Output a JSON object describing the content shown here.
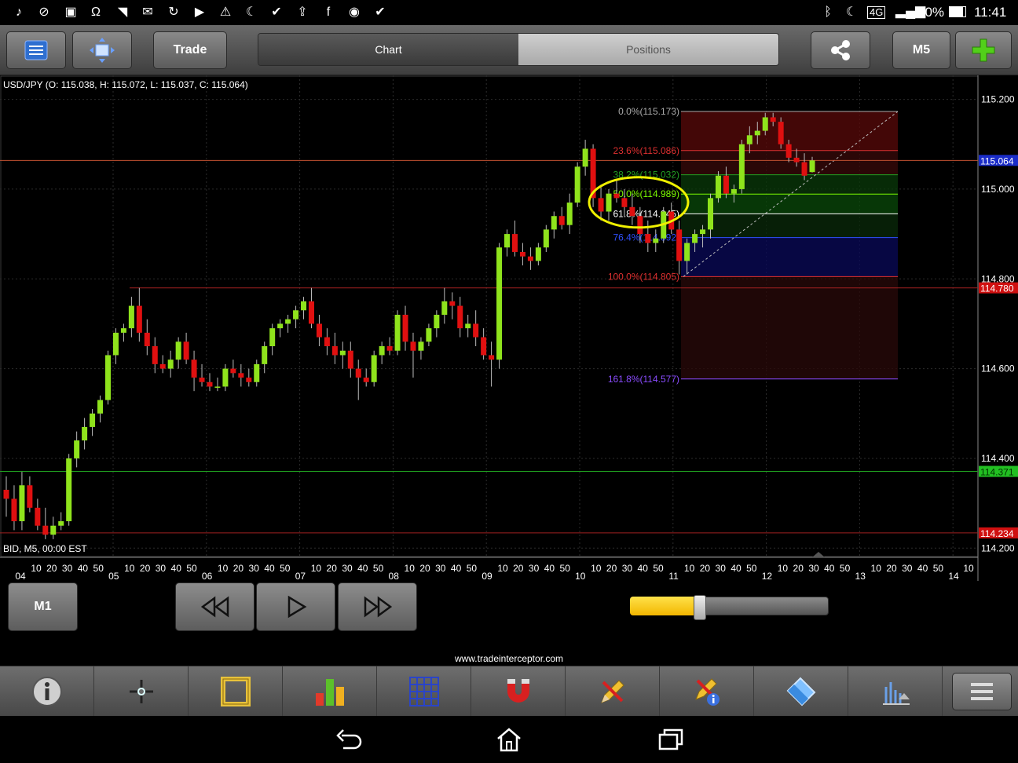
{
  "status_bar": {
    "left_icons": [
      "music-icon",
      "no-sim-icon",
      "image-icon",
      "headset-icon",
      "wifi-question-icon",
      "gmail-icon",
      "sync-icon",
      "youtube-icon",
      "warning-icon",
      "moon-icon",
      "clipboard-check-icon",
      "clipboard-up-icon",
      "facebook-icon",
      "messenger-icon",
      "clipboard-check-icon"
    ],
    "battery": "90%",
    "time": "11:41",
    "network": "4G"
  },
  "toolbar": {
    "trade_label": "Trade",
    "tabs": [
      {
        "label": "Chart",
        "active": true
      },
      {
        "label": "Positions",
        "active": false
      }
    ],
    "timeframe_label": "M5"
  },
  "chart": {
    "pair_info": "USD/JPY (O: 115.038, H: 115.072, L: 115.037, C: 115.064)",
    "bid_info": "BID, M5, 00:00 EST",
    "price_ticks": [
      {
        "label": "115.200",
        "v": 115.2
      },
      {
        "label": "115.000",
        "v": 115.0
      },
      {
        "label": "114.800",
        "v": 114.8
      },
      {
        "label": "114.600",
        "v": 114.6
      },
      {
        "label": "114.400",
        "v": 114.4
      },
      {
        "label": "114.200",
        "v": 114.2
      }
    ],
    "price_markers": [
      {
        "label": "115.064",
        "v": 115.064,
        "bg": "#1a2cc8",
        "color": "#ffffff",
        "line": "#c05030"
      },
      {
        "label": "114.780",
        "v": 114.78,
        "bg": "#d01010",
        "color": "#ffffff",
        "line": "#a02020"
      },
      {
        "label": "114.371",
        "v": 114.371,
        "bg": "#22c022",
        "color": "#003300",
        "line": "#20a020"
      },
      {
        "label": "114.234",
        "v": 114.234,
        "bg": "#d01010",
        "color": "#ffffff",
        "line": "#a02020"
      }
    ],
    "fib_levels": [
      {
        "label": "0.0%(115.173)",
        "v": 115.173,
        "color": "#aaaaaa"
      },
      {
        "label": "23.6%(115.086)",
        "v": 115.086,
        "color": "#e03030"
      },
      {
        "label": "38.2%(115.032)",
        "v": 115.032,
        "color": "#22a022"
      },
      {
        "label": "50.0%(114.989)",
        "v": 114.989,
        "color": "#7cfc00"
      },
      {
        "label": "61.8%(114.945)",
        "v": 114.945,
        "color": "#ffffff"
      },
      {
        "label": "76.4%(114.892)",
        "v": 114.892,
        "color": "#3050ff"
      },
      {
        "label": "100.0%(114.805)",
        "v": 114.805,
        "color": "#e03030"
      },
      {
        "label": "161.8%(114.577)",
        "v": 114.577,
        "color": "#8a4cff"
      }
    ],
    "time_axis": {
      "minor": [
        "10",
        "20",
        "30",
        "40",
        "50"
      ],
      "days": [
        "04",
        "05",
        "06",
        "07",
        "08",
        "09",
        "10",
        "11",
        "12",
        "13",
        "14"
      ]
    },
    "colors": {
      "up": "#8fe31c",
      "down": "#e01010",
      "grid": "#2c2c2c",
      "highlight": "#f0f000"
    }
  },
  "chart_data": {
    "type": "candlestick",
    "title": "USD/JPY (O: 115.038, H: 115.072, L: 115.037, C: 115.064)",
    "ylim": [
      114.2,
      115.2
    ],
    "x": [
      "04",
      "05",
      "06",
      "07",
      "08",
      "09",
      "10",
      "11",
      "12"
    ],
    "candles": [
      {
        "o": 114.33,
        "h": 114.36,
        "l": 114.27,
        "c": 114.31
      },
      {
        "o": 114.31,
        "h": 114.34,
        "l": 114.24,
        "c": 114.26
      },
      {
        "o": 114.26,
        "h": 114.37,
        "l": 114.24,
        "c": 114.34
      },
      {
        "o": 114.34,
        "h": 114.36,
        "l": 114.28,
        "c": 114.29
      },
      {
        "o": 114.29,
        "h": 114.31,
        "l": 114.24,
        "c": 114.25
      },
      {
        "o": 114.25,
        "h": 114.29,
        "l": 114.22,
        "c": 114.23
      },
      {
        "o": 114.23,
        "h": 114.27,
        "l": 114.22,
        "c": 114.25
      },
      {
        "o": 114.25,
        "h": 114.28,
        "l": 114.24,
        "c": 114.26
      },
      {
        "o": 114.26,
        "h": 114.41,
        "l": 114.25,
        "c": 114.4
      },
      {
        "o": 114.4,
        "h": 114.46,
        "l": 114.38,
        "c": 114.44
      },
      {
        "o": 114.44,
        "h": 114.49,
        "l": 114.42,
        "c": 114.47
      },
      {
        "o": 114.47,
        "h": 114.51,
        "l": 114.45,
        "c": 114.5
      },
      {
        "o": 114.5,
        "h": 114.54,
        "l": 114.48,
        "c": 114.53
      },
      {
        "o": 114.53,
        "h": 114.64,
        "l": 114.52,
        "c": 114.63
      },
      {
        "o": 114.63,
        "h": 114.69,
        "l": 114.61,
        "c": 114.68
      },
      {
        "o": 114.68,
        "h": 114.7,
        "l": 114.66,
        "c": 114.69
      },
      {
        "o": 114.69,
        "h": 114.76,
        "l": 114.67,
        "c": 114.74
      },
      {
        "o": 114.74,
        "h": 114.78,
        "l": 114.66,
        "c": 114.68
      },
      {
        "o": 114.68,
        "h": 114.71,
        "l": 114.63,
        "c": 114.65
      },
      {
        "o": 114.65,
        "h": 114.67,
        "l": 114.59,
        "c": 114.61
      },
      {
        "o": 114.61,
        "h": 114.63,
        "l": 114.59,
        "c": 114.6
      },
      {
        "o": 114.6,
        "h": 114.64,
        "l": 114.58,
        "c": 114.62
      },
      {
        "o": 114.62,
        "h": 114.67,
        "l": 114.6,
        "c": 114.66
      },
      {
        "o": 114.66,
        "h": 114.68,
        "l": 114.61,
        "c": 114.62
      },
      {
        "o": 114.62,
        "h": 114.64,
        "l": 114.55,
        "c": 114.58
      },
      {
        "o": 114.58,
        "h": 114.61,
        "l": 114.56,
        "c": 114.57
      },
      {
        "o": 114.57,
        "h": 114.59,
        "l": 114.55,
        "c": 114.56
      },
      {
        "o": 114.56,
        "h": 114.58,
        "l": 114.55,
        "c": 114.56
      },
      {
        "o": 114.56,
        "h": 114.61,
        "l": 114.55,
        "c": 114.6
      },
      {
        "o": 114.6,
        "h": 114.62,
        "l": 114.58,
        "c": 114.59
      },
      {
        "o": 114.59,
        "h": 114.61,
        "l": 114.56,
        "c": 114.58
      },
      {
        "o": 114.58,
        "h": 114.6,
        "l": 114.56,
        "c": 114.57
      },
      {
        "o": 114.57,
        "h": 114.62,
        "l": 114.56,
        "c": 114.61
      },
      {
        "o": 114.61,
        "h": 114.66,
        "l": 114.59,
        "c": 114.65
      },
      {
        "o": 114.65,
        "h": 114.7,
        "l": 114.63,
        "c": 114.69
      },
      {
        "o": 114.69,
        "h": 114.71,
        "l": 114.67,
        "c": 114.7
      },
      {
        "o": 114.7,
        "h": 114.72,
        "l": 114.68,
        "c": 114.71
      },
      {
        "o": 114.71,
        "h": 114.74,
        "l": 114.69,
        "c": 114.73
      },
      {
        "o": 114.73,
        "h": 114.76,
        "l": 114.71,
        "c": 114.75
      },
      {
        "o": 114.75,
        "h": 114.78,
        "l": 114.69,
        "c": 114.7
      },
      {
        "o": 114.7,
        "h": 114.72,
        "l": 114.65,
        "c": 114.67
      },
      {
        "o": 114.67,
        "h": 114.69,
        "l": 114.63,
        "c": 114.65
      },
      {
        "o": 114.65,
        "h": 114.68,
        "l": 114.61,
        "c": 114.63
      },
      {
        "o": 114.63,
        "h": 114.66,
        "l": 114.6,
        "c": 114.64
      },
      {
        "o": 114.64,
        "h": 114.66,
        "l": 114.58,
        "c": 114.6
      },
      {
        "o": 114.6,
        "h": 114.62,
        "l": 114.53,
        "c": 114.58
      },
      {
        "o": 114.58,
        "h": 114.6,
        "l": 114.56,
        "c": 114.57
      },
      {
        "o": 114.57,
        "h": 114.64,
        "l": 114.56,
        "c": 114.63
      },
      {
        "o": 114.63,
        "h": 114.66,
        "l": 114.61,
        "c": 114.65
      },
      {
        "o": 114.65,
        "h": 114.67,
        "l": 114.63,
        "c": 114.64
      },
      {
        "o": 114.64,
        "h": 114.73,
        "l": 114.63,
        "c": 114.72
      },
      {
        "o": 114.72,
        "h": 114.74,
        "l": 114.64,
        "c": 114.66
      },
      {
        "o": 114.66,
        "h": 114.68,
        "l": 114.58,
        "c": 114.64
      },
      {
        "o": 114.64,
        "h": 114.67,
        "l": 114.62,
        "c": 114.66
      },
      {
        "o": 114.66,
        "h": 114.7,
        "l": 114.65,
        "c": 114.69
      },
      {
        "o": 114.69,
        "h": 114.73,
        "l": 114.67,
        "c": 114.72
      },
      {
        "o": 114.72,
        "h": 114.78,
        "l": 114.7,
        "c": 114.75
      },
      {
        "o": 114.75,
        "h": 114.77,
        "l": 114.71,
        "c": 114.74
      },
      {
        "o": 114.74,
        "h": 114.76,
        "l": 114.67,
        "c": 114.69
      },
      {
        "o": 114.69,
        "h": 114.72,
        "l": 114.67,
        "c": 114.7
      },
      {
        "o": 114.7,
        "h": 114.73,
        "l": 114.65,
        "c": 114.67
      },
      {
        "o": 114.67,
        "h": 114.69,
        "l": 114.62,
        "c": 114.63
      },
      {
        "o": 114.63,
        "h": 114.66,
        "l": 114.56,
        "c": 114.62
      },
      {
        "o": 114.62,
        "h": 114.88,
        "l": 114.6,
        "c": 114.87
      },
      {
        "o": 114.87,
        "h": 114.91,
        "l": 114.85,
        "c": 114.9
      },
      {
        "o": 114.9,
        "h": 114.93,
        "l": 114.85,
        "c": 114.86
      },
      {
        "o": 114.86,
        "h": 114.88,
        "l": 114.83,
        "c": 114.85
      },
      {
        "o": 114.85,
        "h": 114.87,
        "l": 114.82,
        "c": 114.84
      },
      {
        "o": 114.84,
        "h": 114.88,
        "l": 114.83,
        "c": 114.87
      },
      {
        "o": 114.87,
        "h": 114.92,
        "l": 114.86,
        "c": 114.91
      },
      {
        "o": 114.91,
        "h": 114.95,
        "l": 114.89,
        "c": 114.94
      },
      {
        "o": 114.94,
        "h": 114.96,
        "l": 114.91,
        "c": 114.92
      },
      {
        "o": 114.92,
        "h": 114.99,
        "l": 114.9,
        "c": 114.97
      },
      {
        "o": 114.97,
        "h": 115.06,
        "l": 114.96,
        "c": 115.05
      },
      {
        "o": 115.05,
        "h": 115.11,
        "l": 115.03,
        "c": 115.09
      },
      {
        "o": 115.09,
        "h": 115.1,
        "l": 114.96,
        "c": 114.98
      },
      {
        "o": 114.98,
        "h": 115.01,
        "l": 114.93,
        "c": 114.95
      },
      {
        "o": 114.95,
        "h": 115.0,
        "l": 114.93,
        "c": 114.99
      },
      {
        "o": 114.99,
        "h": 115.02,
        "l": 114.97,
        "c": 114.98
      },
      {
        "o": 114.98,
        "h": 115.0,
        "l": 114.94,
        "c": 114.96
      },
      {
        "o": 114.96,
        "h": 114.99,
        "l": 114.92,
        "c": 114.94
      },
      {
        "o": 114.94,
        "h": 114.96,
        "l": 114.88,
        "c": 114.9
      },
      {
        "o": 114.9,
        "h": 114.93,
        "l": 114.86,
        "c": 114.88
      },
      {
        "o": 114.88,
        "h": 114.91,
        "l": 114.86,
        "c": 114.89
      },
      {
        "o": 114.89,
        "h": 114.96,
        "l": 114.88,
        "c": 114.95
      },
      {
        "o": 114.95,
        "h": 114.97,
        "l": 114.9,
        "c": 114.91
      },
      {
        "o": 114.91,
        "h": 114.93,
        "l": 114.81,
        "c": 114.84
      },
      {
        "o": 114.84,
        "h": 114.89,
        "l": 114.81,
        "c": 114.88
      },
      {
        "o": 114.88,
        "h": 114.91,
        "l": 114.86,
        "c": 114.9
      },
      {
        "o": 114.9,
        "h": 114.92,
        "l": 114.87,
        "c": 114.91
      },
      {
        "o": 114.91,
        "h": 114.99,
        "l": 114.89,
        "c": 114.98
      },
      {
        "o": 114.98,
        "h": 115.04,
        "l": 114.97,
        "c": 115.03
      },
      {
        "o": 115.03,
        "h": 115.05,
        "l": 114.98,
        "c": 114.99
      },
      {
        "o": 114.99,
        "h": 115.01,
        "l": 114.97,
        "c": 115.0
      },
      {
        "o": 115.0,
        "h": 115.11,
        "l": 114.99,
        "c": 115.1
      },
      {
        "o": 115.1,
        "h": 115.14,
        "l": 115.08,
        "c": 115.12
      },
      {
        "o": 115.12,
        "h": 115.15,
        "l": 115.1,
        "c": 115.13
      },
      {
        "o": 115.13,
        "h": 115.17,
        "l": 115.12,
        "c": 115.16
      },
      {
        "o": 115.16,
        "h": 115.17,
        "l": 115.14,
        "c": 115.15
      },
      {
        "o": 115.15,
        "h": 115.16,
        "l": 115.09,
        "c": 115.1
      },
      {
        "o": 115.1,
        "h": 115.11,
        "l": 115.06,
        "c": 115.07
      },
      {
        "o": 115.07,
        "h": 115.09,
        "l": 115.05,
        "c": 115.06
      },
      {
        "o": 115.06,
        "h": 115.08,
        "l": 115.02,
        "c": 115.03
      },
      {
        "o": 115.038,
        "h": 115.072,
        "l": 115.037,
        "c": 115.064
      }
    ]
  },
  "controls": {
    "timeframe_button": "M1",
    "slider_value": 0.35
  },
  "website": "www.tradeinterceptor.com",
  "bottom_tools": [
    "info-icon",
    "crosshair-icon",
    "ruler-frame-icon",
    "bar-chart-icon",
    "grid-icon",
    "magnet-icon",
    "pencil-draw-icon",
    "pencil-info-icon",
    "eraser-icon",
    "indicators-icon"
  ]
}
